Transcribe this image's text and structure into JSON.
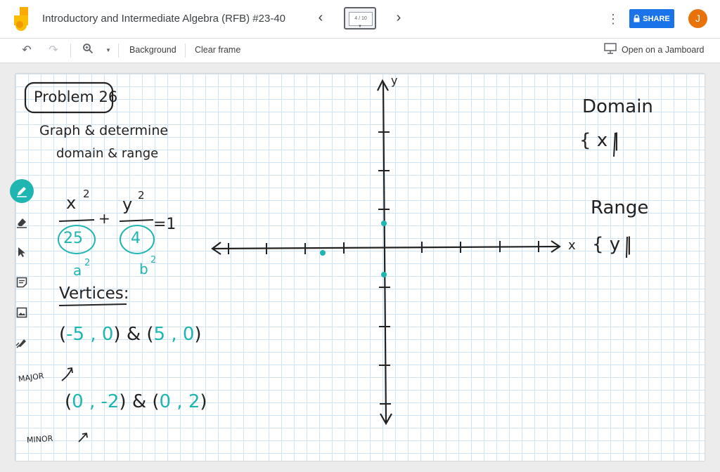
{
  "header": {
    "title": "Introductory and Intermediate Algebra (RFB) #23-40",
    "frame_indicator": "4 / 10",
    "share_label": "SHARE",
    "avatar_initial": "J"
  },
  "toolbar": {
    "background_label": "Background",
    "clear_frame_label": "Clear frame",
    "open_jamboard_label": "Open on a Jamboard"
  },
  "tools": [
    {
      "name": "pen",
      "icon": "pen-icon",
      "active": true
    },
    {
      "name": "eraser",
      "icon": "eraser-icon",
      "active": false
    },
    {
      "name": "select",
      "icon": "cursor-icon",
      "active": false
    },
    {
      "name": "sticky-note",
      "icon": "sticky-note-icon",
      "active": false
    },
    {
      "name": "image",
      "icon": "image-icon",
      "active": false
    },
    {
      "name": "laser",
      "icon": "laser-icon",
      "active": false
    }
  ],
  "colors": {
    "accent": "#1a73e8",
    "avatar": "#e8710a",
    "ink": "#222222",
    "ink_teal": "#1fb5b0",
    "grid": "#cfe3f2"
  },
  "board": {
    "problem_label": "Problem 26",
    "instruction_line1": "Graph & determine",
    "instruction_line2": "domain & range",
    "eq_x_num": "x",
    "eq_x_exp": "2",
    "eq_y_num": "y",
    "eq_y_exp": "2",
    "eq_x_den": "25",
    "eq_y_den": "4",
    "eq_plus": "+",
    "eq_rhs": "=1",
    "a_label": "a",
    "a_exp": "2",
    "b_label": "b",
    "b_exp": "2",
    "vertices_label": "Vertices:",
    "major_vertices_open": "(",
    "major_v1": "-5 , 0",
    "major_between": ") & (",
    "major_v2": "5 , 0",
    "major_close": ")",
    "major_label": "MAJOR",
    "minor_vertices_open": "(",
    "minor_v1": "0 , -2",
    "minor_between": ") & (",
    "minor_v2": "0 , 2",
    "minor_close": ")",
    "minor_label": "MINOR",
    "axis_x_label": "x",
    "axis_y_label": "y",
    "domain_label": "Domain",
    "domain_set": "{ x |",
    "range_label": "Range",
    "range_set": "{ y |"
  }
}
